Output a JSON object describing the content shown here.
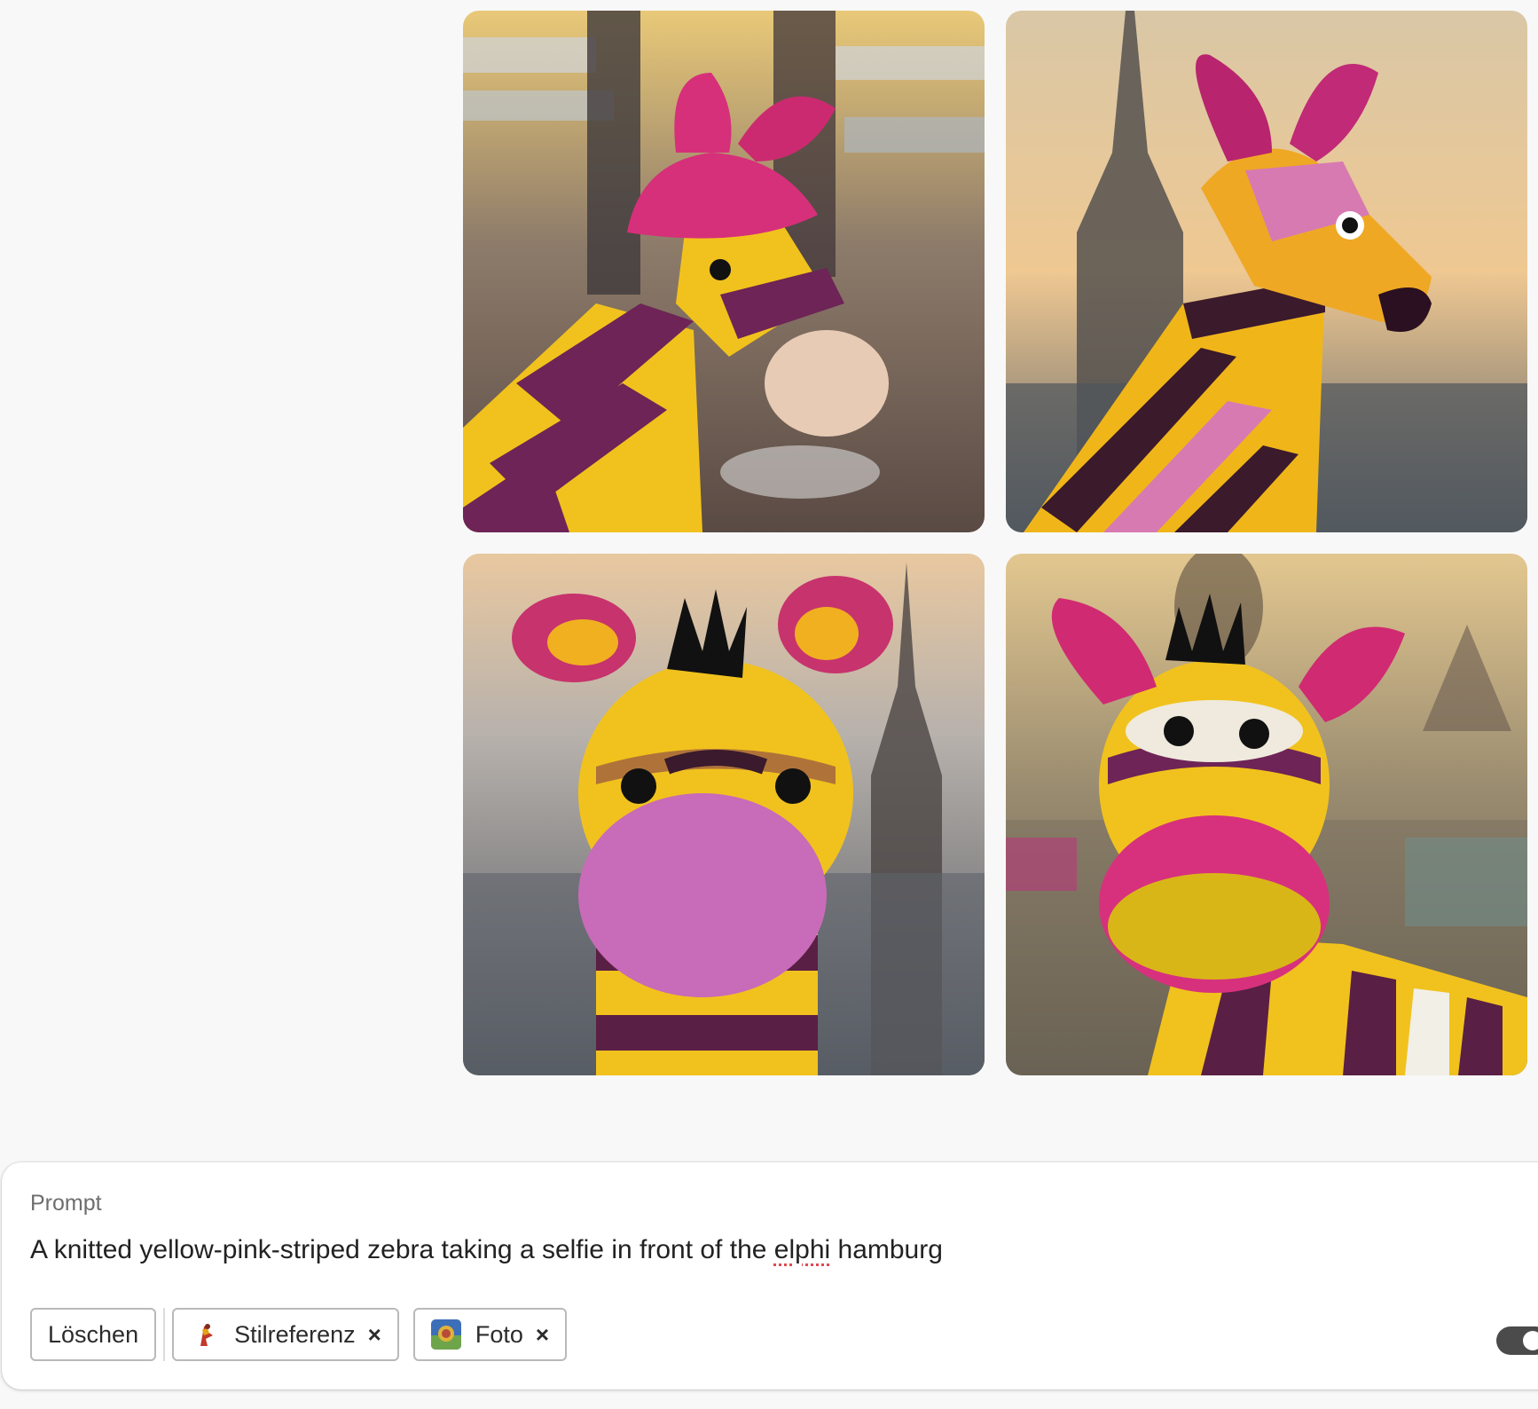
{
  "gallery": {
    "images": [
      {
        "alt": "",
        "name": "generated-image-1"
      },
      {
        "alt": "",
        "name": "generated-image-2"
      },
      {
        "alt": "",
        "name": "generated-image-3"
      },
      {
        "alt": "",
        "name": "generated-image-4"
      }
    ]
  },
  "prompt": {
    "label": "Prompt",
    "text_before": "A knitted yellow-pink-striped zebra taking a selfie in front of the ",
    "text_misspelled": "elphi",
    "text_after": " hamburg"
  },
  "chips": {
    "clear_label": "Löschen",
    "style_ref_label": "Stilreferenz",
    "style_ref_icon": "style-reference-thumbnail",
    "photo_label": "Foto",
    "photo_icon": "photo-content-type-thumbnail",
    "remove_glyph": "×"
  },
  "colors": {
    "accent_misspelling": "#e34850",
    "toggle": "#4b4b4b"
  }
}
